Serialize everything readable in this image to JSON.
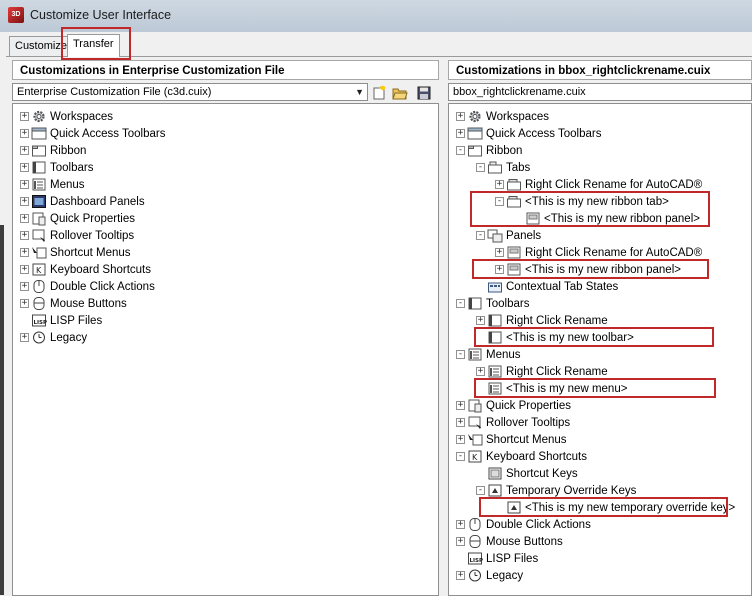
{
  "window": {
    "title": "Customize User Interface",
    "app_icon_text": "3D"
  },
  "tabs": [
    {
      "label": "Customize"
    },
    {
      "label": "Transfer"
    }
  ],
  "left_pane": {
    "header": "Customizations in Enterprise Customization File",
    "file_selector": "Enterprise Customization File (c3d.cuix)",
    "tree": [
      {
        "label": "Workspaces",
        "icon": "gear-icon"
      },
      {
        "label": "Quick Access Toolbars",
        "icon": "quick-access-icon"
      },
      {
        "label": "Ribbon",
        "icon": "ribbon-icon"
      },
      {
        "label": "Toolbars",
        "icon": "toolbar-icon"
      },
      {
        "label": "Menus",
        "icon": "menu-icon"
      },
      {
        "label": "Dashboard Panels",
        "icon": "dashboard-icon"
      },
      {
        "label": "Quick Properties",
        "icon": "quick-properties-icon"
      },
      {
        "label": "Rollover Tooltips",
        "icon": "rollover-icon"
      },
      {
        "label": "Shortcut Menus",
        "icon": "shortcut-menu-icon"
      },
      {
        "label": "Keyboard Shortcuts",
        "icon": "keyboard-icon"
      },
      {
        "label": "Double Click Actions",
        "icon": "double-click-icon"
      },
      {
        "label": "Mouse Buttons",
        "icon": "mouse-icon"
      },
      {
        "label": "LISP Files",
        "icon": "lisp-icon"
      },
      {
        "label": "Legacy",
        "icon": "legacy-icon"
      }
    ]
  },
  "right_pane": {
    "header": "Customizations in bbox_rightclickrename.cuix",
    "file_name": "bbox_rightclickrename.cuix",
    "tree": [
      {
        "label": "Workspaces",
        "icon": "gear-icon"
      },
      {
        "label": "Quick Access Toolbars",
        "icon": "quick-access-icon"
      },
      {
        "label": "Ribbon",
        "icon": "ribbon-icon"
      },
      {
        "label": "Tabs",
        "icon": "ribbon-tabs-icon"
      },
      {
        "label": "Right Click Rename for AutoCAD®",
        "icon": "ribbon-tab-icon"
      },
      {
        "label": "<This is my new ribbon tab>",
        "icon": "ribbon-tab-icon"
      },
      {
        "label": "<This is my new ribbon panel>",
        "icon": "ribbon-panel-icon"
      },
      {
        "label": "Panels",
        "icon": "ribbon-panels-icon"
      },
      {
        "label": "Right Click Rename for AutoCAD®",
        "icon": "ribbon-panel-icon"
      },
      {
        "label": "<This is my new ribbon panel>",
        "icon": "ribbon-panel-icon"
      },
      {
        "label": "Contextual Tab States",
        "icon": "contextual-tab-icon"
      },
      {
        "label": "Toolbars",
        "icon": "toolbar-icon"
      },
      {
        "label": "Right Click Rename",
        "icon": "toolbar-icon"
      },
      {
        "label": "<This is my new toolbar>",
        "icon": "toolbar-icon"
      },
      {
        "label": "Menus",
        "icon": "menu-icon"
      },
      {
        "label": "Right Click Rename",
        "icon": "menu-icon"
      },
      {
        "label": "<This is my new menu>",
        "icon": "menu-icon"
      },
      {
        "label": "Quick Properties",
        "icon": "quick-properties-icon"
      },
      {
        "label": "Rollover Tooltips",
        "icon": "rollover-icon"
      },
      {
        "label": "Shortcut Menus",
        "icon": "shortcut-menu-icon"
      },
      {
        "label": "Keyboard Shortcuts",
        "icon": "keyboard-icon"
      },
      {
        "label": "Shortcut Keys",
        "icon": "shortcut-keys-icon"
      },
      {
        "label": "Temporary Override Keys",
        "icon": "override-keys-icon"
      },
      {
        "label": "<This is my new temporary override key>",
        "icon": "override-key-icon"
      },
      {
        "label": "Double Click Actions",
        "icon": "double-click-icon"
      },
      {
        "label": "Mouse Buttons",
        "icon": "mouse-icon"
      },
      {
        "label": "LISP Files",
        "icon": "lisp-icon"
      },
      {
        "label": "Legacy",
        "icon": "legacy-icon"
      }
    ]
  },
  "colors": {
    "highlight_border": "#c0282a",
    "title_bar": "#c6d1dc"
  }
}
